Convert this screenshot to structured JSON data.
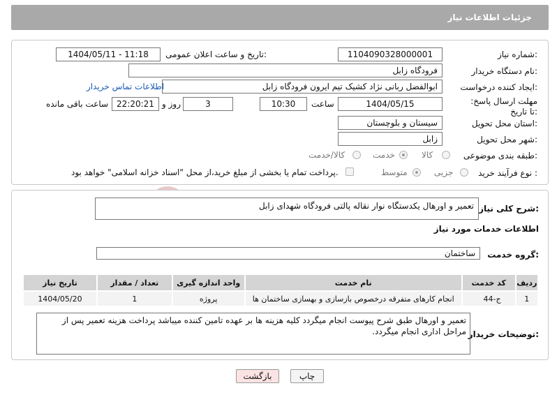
{
  "header": {
    "title": "جزئیات اطلاعات نیاز"
  },
  "watermark": {
    "text": "AriaTender.neT"
  },
  "form": {
    "need_number_label": "شماره نیاز:",
    "need_number": "1104090328000001",
    "announce_label": "تاریخ و ساعت اعلان عمومی:",
    "announce_value": "1404/05/11 - 11:18",
    "buyer_org_label": "نام دستگاه خریدار:",
    "buyer_org": "فرودگاه زابل",
    "creator_label": "ایجاد کننده درخواست:",
    "creator": "ابوالفضل  ربانی نژاد کشیک تیم ایرون فرودگاه زابل",
    "contact_link": "اطلاعات تماس خریدار",
    "deadline_label": "مهلت ارسال پاسخ: تا تاریخ:",
    "deadline_date": "1404/05/15",
    "time_label": "ساعت",
    "deadline_time": "10:30",
    "days": "3",
    "days_label": "روز و",
    "remaining_time": "22:20:21",
    "remaining_label": "ساعت باقی مانده",
    "province_label": "استان محل تحویل:",
    "province": "سیستان و بلوچستان",
    "city_label": "شهر محل تحویل:",
    "city": "زابل",
    "category_label": "طبقه بندی موضوعی:",
    "category_options": [
      "کالا",
      "خدمت",
      "کالا/خدمت"
    ],
    "category_selected": "خدمت",
    "process_label": "نوع فرآیند خرید :",
    "process_options": [
      "جزیی",
      "متوسط"
    ],
    "process_selected": "متوسط",
    "payment_note": "پرداخت تمام یا بخشی از مبلغ خرید،از محل \"اسناد خزانه اسلامی\" خواهد بود."
  },
  "summary": {
    "label": "شرح کلی نیاز:",
    "text": "تعمیر و اورهال یکدستگاه نوار نقاله پالتی فرودگاه شهدای زابل",
    "services_title": "اطلاعات خدمات مورد نیاز",
    "group_label": "گروه خدمت:",
    "group_value": "ساختمان"
  },
  "table": {
    "headers": [
      "ردیف",
      "کد خدمت",
      "نام خدمت",
      "واحد اندازه گیری",
      "تعداد / مقدار",
      "تاریخ نیاز"
    ],
    "rows": [
      [
        "1",
        "ج-44",
        "انجام کارهای متفرقه درخصوص بازسازی و بهسازی ساختمان ها",
        "پروژه",
        "1",
        "1404/05/20"
      ]
    ]
  },
  "notes": {
    "label": "توضیحات خریدار:",
    "text": "تعمیر و اورهال طبق شرح پیوست انجام میگردد کلیه هزینه ها بر عهده تامین کننده میباشد پرداخت هزینه تعمیر پس از مراحل اداری انجام میگردد."
  },
  "buttons": {
    "print": "چاپ",
    "back": "بازگشت"
  },
  "colors": {
    "header": "#a9a9a9",
    "link": "#1a5bb5",
    "back_button": "#fbe3e3",
    "watermark": "#e8c9c9"
  }
}
